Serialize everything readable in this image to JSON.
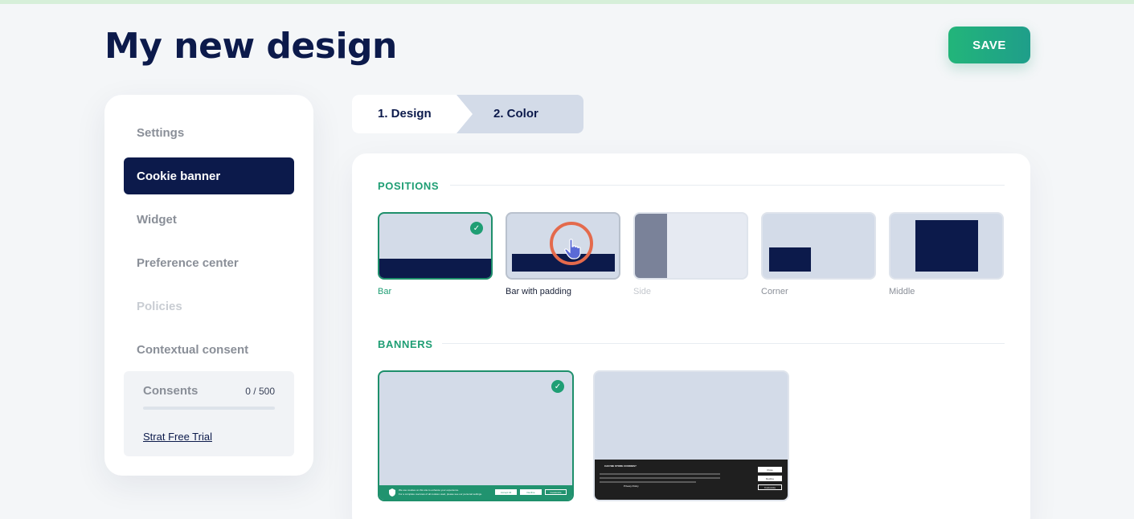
{
  "page": {
    "title": "My new design",
    "save_label": "SAVE"
  },
  "sidebar": {
    "items": [
      {
        "label": "Settings",
        "state": "normal"
      },
      {
        "label": "Cookie banner",
        "state": "active"
      },
      {
        "label": "Widget",
        "state": "normal"
      },
      {
        "label": "Preference center",
        "state": "normal"
      },
      {
        "label": "Policies",
        "state": "disabled"
      },
      {
        "label": "Contextual consent",
        "state": "normal"
      }
    ],
    "consents": {
      "label": "Consents",
      "count": "0 / 500",
      "progress": 0,
      "trial_link": "Strat Free Trial"
    }
  },
  "steps": [
    {
      "label": "1. Design",
      "active": true
    },
    {
      "label": "2. Color",
      "active": false
    }
  ],
  "positions": {
    "title": "POSITIONS",
    "options": [
      {
        "label": "Bar",
        "selected": true
      },
      {
        "label": "Bar with padding",
        "selected": false
      },
      {
        "label": "Side",
        "selected": false
      },
      {
        "label": "Corner",
        "selected": false
      },
      {
        "label": "Middle",
        "selected": false
      }
    ]
  },
  "banners": {
    "title": "BANNERS",
    "options": [
      {
        "style": "green",
        "selected": true,
        "preview": {
          "text_line_1": "We use cookies on this site to enhance your experience.",
          "text_line_2": "For a complete overview of all cookies used, please see our personal settings.",
          "buttons": [
            "Accept All",
            "Decline",
            "Customize"
          ]
        }
      },
      {
        "style": "dark",
        "selected": false,
        "preview": {
          "heading": "CAN WE STORE COOKIES?",
          "buttons": [
            "Close",
            "Decline",
            "Customize"
          ],
          "footer": "Privacy Policy"
        }
      }
    ]
  },
  "colors": {
    "navy": "#0c1a4b",
    "green": "#1f9e74",
    "card": "#d3dbe8"
  },
  "icons": [
    "check-icon",
    "hand-pointer-icon",
    "shield-icon"
  ]
}
